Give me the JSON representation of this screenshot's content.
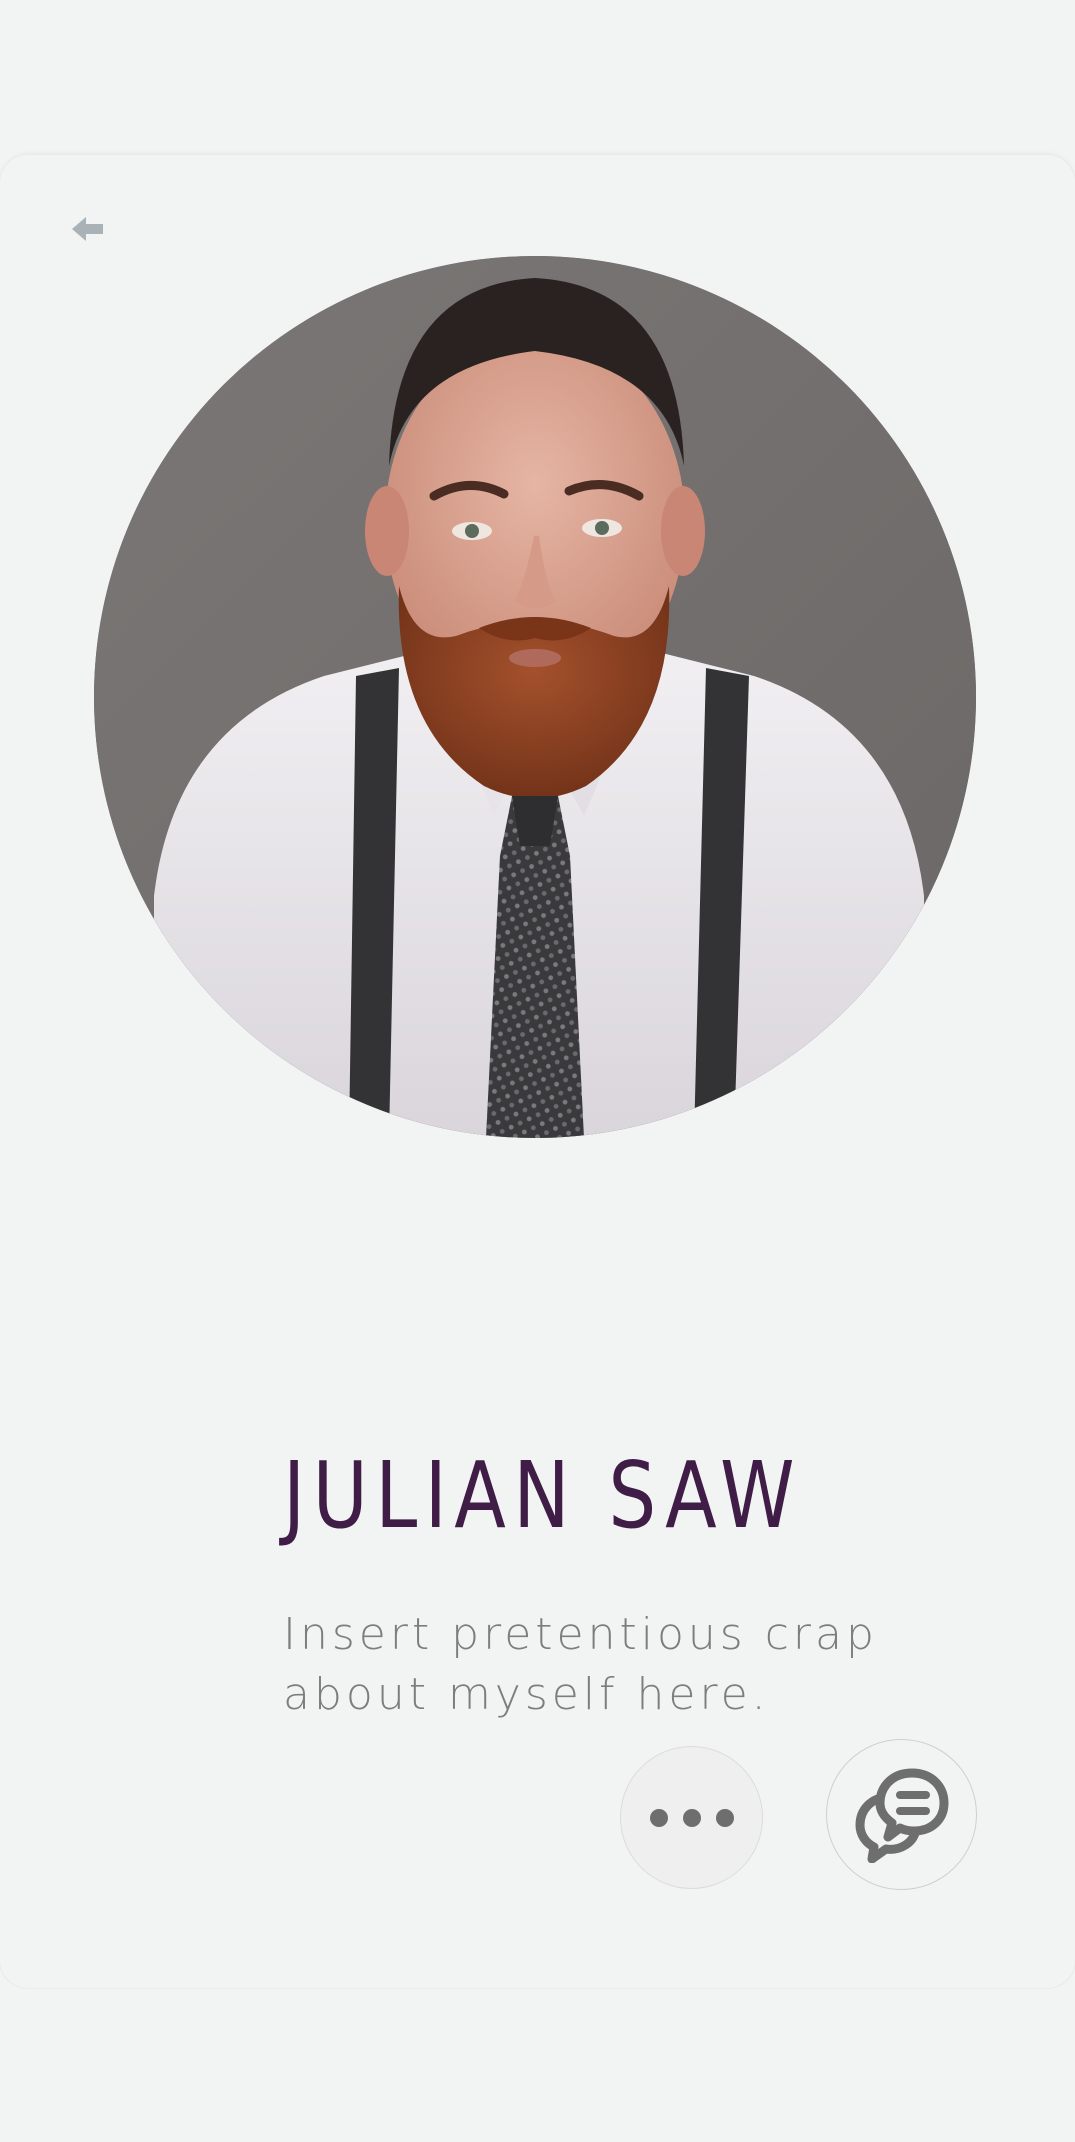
{
  "profile": {
    "name": "JULIAN SAW",
    "bio": "Insert pretentious crap about myself here."
  },
  "icons": {
    "back": "arrow-left-icon",
    "more": "more-horizontal-icon",
    "chat": "chat-bubbles-icon"
  },
  "colors": {
    "background": "#f2f3f3",
    "name": "#3f1d47",
    "bio": "#7d7d7d",
    "back_icon": "#a9b3b7",
    "action_icon": "#6e6e6e"
  }
}
